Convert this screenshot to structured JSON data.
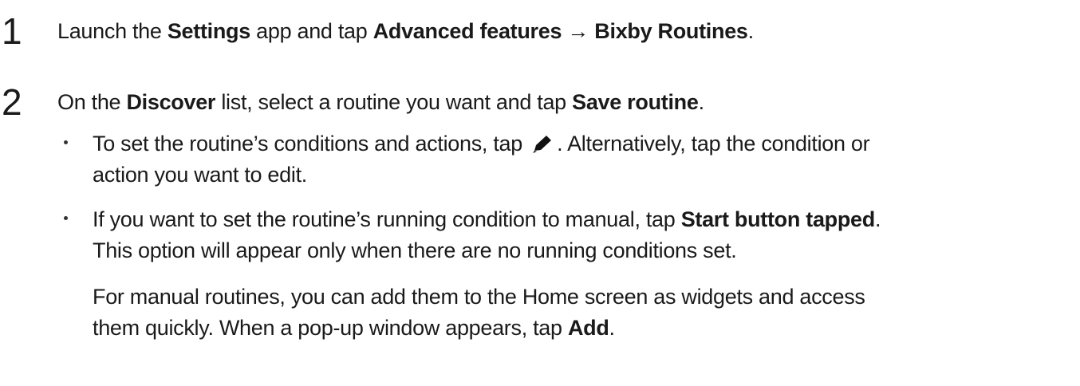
{
  "steps": [
    {
      "number": "1",
      "parts": [
        {
          "t": "Launch the ",
          "b": false
        },
        {
          "t": "Settings",
          "b": true
        },
        {
          "t": " app and tap ",
          "b": false
        },
        {
          "t": "Advanced features → Bixby Routines",
          "b": true
        },
        {
          "t": ".",
          "b": false
        }
      ]
    },
    {
      "number": "2",
      "parts": [
        {
          "t": "On the ",
          "b": false
        },
        {
          "t": "Discover",
          "b": true
        },
        {
          "t": " list, select a routine you want and tap ",
          "b": false
        },
        {
          "t": "Save routine",
          "b": true
        },
        {
          "t": ".",
          "b": false
        }
      ]
    }
  ],
  "bullets": [
    {
      "line1_before_icon": "To set the routine’s conditions and actions, tap ",
      "icon": "pencil-icon",
      "line1_after_icon": ". Alternatively, tap the condition or",
      "line2": "action you want to edit."
    },
    {
      "line1_before": "If you want to set the routine’s running condition to manual, tap ",
      "line1_bold": "Start button tapped",
      "line1_after": ".",
      "line2": "This option will appear only when there are no running conditions set."
    }
  ],
  "note": {
    "line1": "For manual routines, you can add them to the Home screen as widgets and access",
    "line2_before": "them quickly. When a pop-up window appears, tap ",
    "line2_bold": "Add",
    "line2_after": "."
  }
}
